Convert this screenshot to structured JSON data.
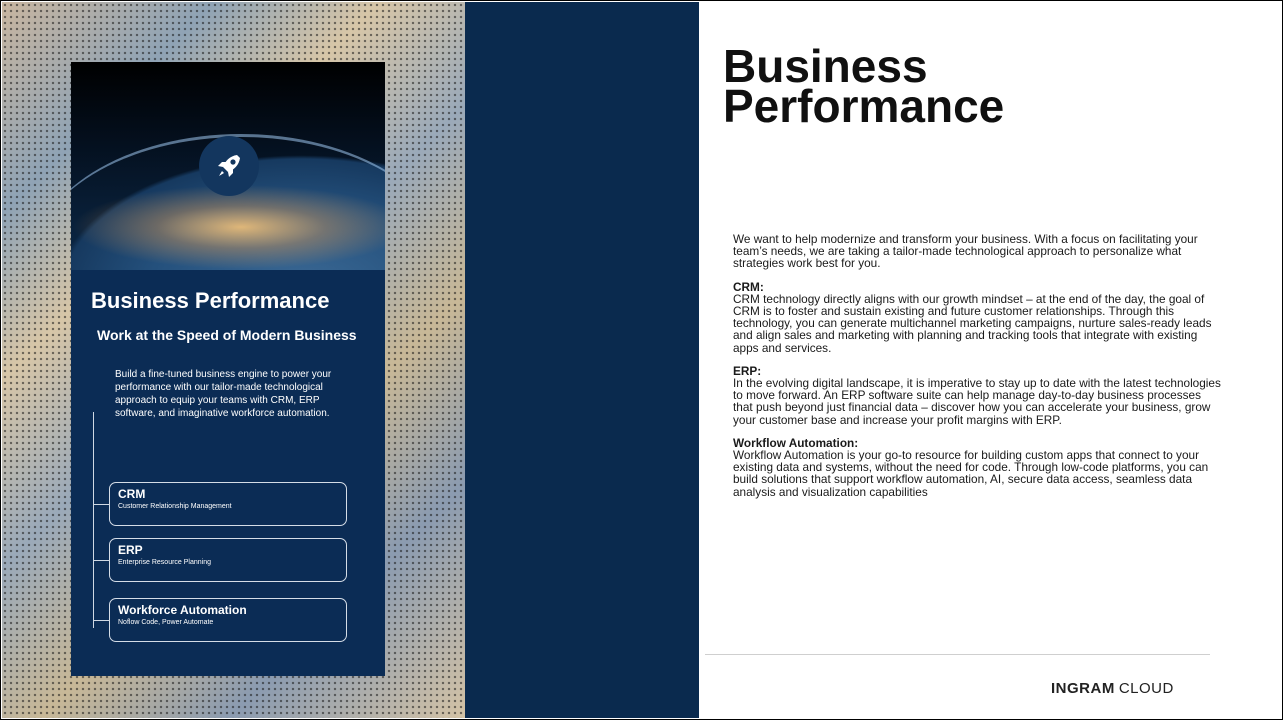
{
  "brochure": {
    "title": "Business Performance",
    "subtitle": "Work at the Speed of Modern Business",
    "body": "Build a fine-tuned business engine to power your performance with our tailor-made technological approach to equip your teams with CRM, ERP software, and imaginative workforce automation.",
    "icon": "rocket-icon",
    "boxes": [
      {
        "title": "CRM",
        "subtitle": "Customer Relationship Management"
      },
      {
        "title": "ERP",
        "subtitle": "Enterprise Resource Planning"
      },
      {
        "title": "Workforce Automation",
        "subtitle": "Noflow Code, Power Automate"
      }
    ]
  },
  "page": {
    "title": "Business Performance",
    "intro": "We want to help modernize and transform your business. With a focus on facilitating your team’s needs, we are taking a tailor-made technological approach to personalize what strategies work best for you.",
    "sections": [
      {
        "heading": "CRM:",
        "text": "CRM technology directly aligns with our growth mindset – at the end of the day, the goal of CRM is to foster and sustain existing and future customer relationships. Through this technology, you can generate multichannel marketing campaigns, nurture sales-ready leads and align sales and marketing with planning and tracking tools that integrate with existing apps and services."
      },
      {
        "heading": "ERP:",
        "text": "In the evolving digital landscape, it is imperative to stay up to date with the latest technologies to move forward. An ERP software suite can help manage day-to-day business processes that push beyond just financial data – discover how you can accelerate your business, grow your customer base and increase your profit margins with ERP."
      },
      {
        "heading": "Workflow Automation:",
        "text": "Workflow Automation is your go-to resource for building custom apps that connect to your existing data and systems, without the need for code. Through low-code platforms, you can build solutions that support workflow automation, AI, secure data access, seamless data analysis and visualization capabilities"
      }
    ]
  },
  "logo": {
    "brand": "INGRAM",
    "product": "CLOUD"
  },
  "colors": {
    "navy": "#0a2a4e",
    "brochure_bg": "#0b2c55"
  }
}
